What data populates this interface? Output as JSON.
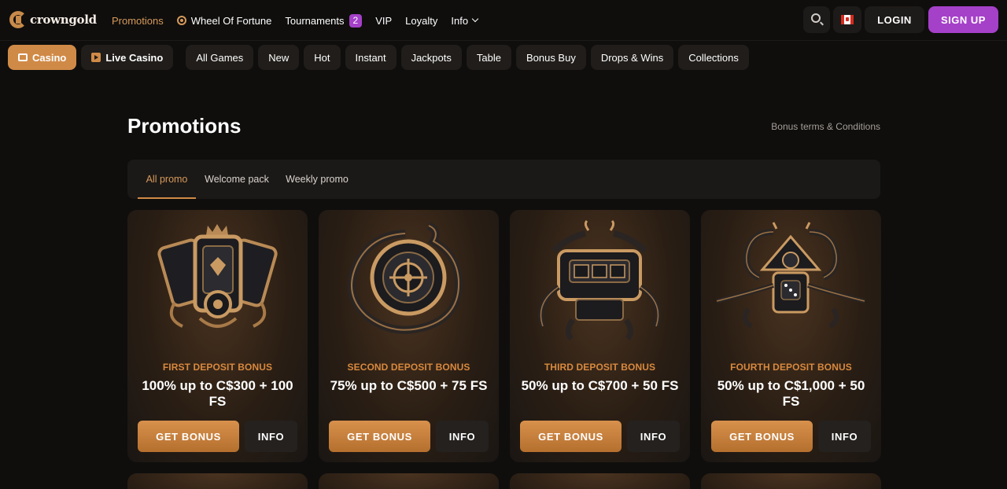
{
  "brand": {
    "name": "crowngold"
  },
  "topnav": {
    "items": [
      {
        "label": "Promotions"
      },
      {
        "label": "Wheel Of Fortune"
      },
      {
        "label": "Tournaments",
        "badge": "2"
      },
      {
        "label": "VIP"
      },
      {
        "label": "Loyalty"
      },
      {
        "label": "Info"
      }
    ]
  },
  "header": {
    "login": "LOGIN",
    "signup": "SIGN UP",
    "search_icon": "search-icon",
    "flag_icon": "canada-flag-icon"
  },
  "categories": {
    "casino": "Casino",
    "live": "Live Casino",
    "items": [
      "All Games",
      "New",
      "Hot",
      "Instant",
      "Jackpots",
      "Table",
      "Bonus Buy",
      "Drops & Wins",
      "Collections"
    ]
  },
  "page": {
    "title": "Promotions",
    "terms": "Bonus terms & Conditions"
  },
  "tabs": [
    "All promo",
    "Welcome pack",
    "Weekly promo"
  ],
  "cards": [
    {
      "label": "FIRST DEPOSIT BONUS",
      "headline": "100% up to C$300 + 100 FS",
      "cta": "GET BONUS",
      "info": "INFO"
    },
    {
      "label": "SECOND DEPOSIT BONUS",
      "headline": "75% up to C$500 + 75 FS",
      "cta": "GET BONUS",
      "info": "INFO"
    },
    {
      "label": "THIRD DEPOSIT BONUS",
      "headline": "50% up to C$700 + 50 FS",
      "cta": "GET BONUS",
      "info": "INFO"
    },
    {
      "label": "FOURTH DEPOSIT BONUS",
      "headline": "50% up to C$1,000 + 50 FS",
      "cta": "GET BONUS",
      "info": "INFO"
    }
  ],
  "colors": {
    "accent": "#d08a47",
    "signup": "#a540c9",
    "background": "#0f0e0d"
  }
}
